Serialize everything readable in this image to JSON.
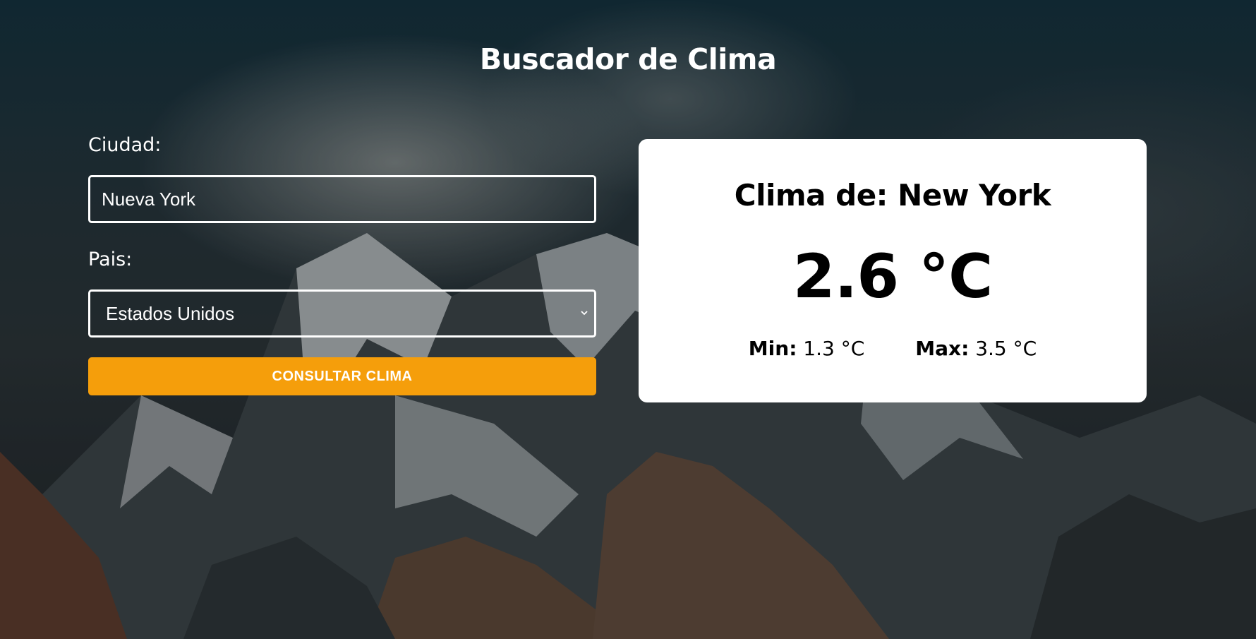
{
  "header": {
    "title": "Buscador de Clima"
  },
  "form": {
    "city_label": "Ciudad:",
    "city_value": "Nueva York",
    "country_label": "Pais:",
    "country_selected": "Estados Unidos",
    "submit_label": "Consultar Clima"
  },
  "weather": {
    "title": "Clima de: New York",
    "temperature": "2.6 °C",
    "min_label": "Min:",
    "min_value": "1.3 °C",
    "max_label": "Max:",
    "max_value": "3.5 °C"
  },
  "colors": {
    "accent": "#f59e0b",
    "card": "#ffffff"
  }
}
